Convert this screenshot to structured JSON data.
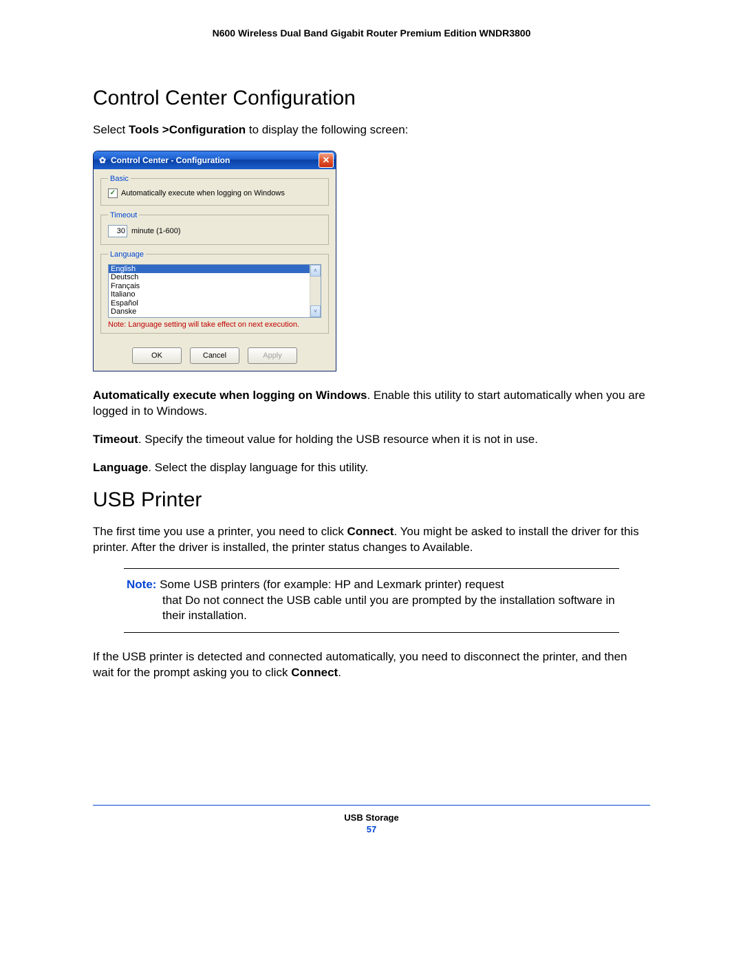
{
  "header": {
    "title": "N600 Wireless Dual Band Gigabit Router Premium Edition WNDR3800"
  },
  "section1": {
    "heading": "Control Center Configuration",
    "intro_prefix": "Select ",
    "intro_bold": "Tools >Configuration",
    "intro_suffix": " to display the following screen:"
  },
  "dialog": {
    "title": "Control Center - Configuration",
    "close_glyph": "✕",
    "gear_glyph": "✿",
    "check_glyph": "✓",
    "basic": {
      "legend": "Basic",
      "checkbox_label": "Automatically execute when logging on Windows",
      "checked": true
    },
    "timeout": {
      "legend": "Timeout",
      "value": "30",
      "unit": "minute (1-600)"
    },
    "language": {
      "legend": "Language",
      "items": [
        "English",
        "Deutsch",
        "Français",
        "Italiano",
        "Español",
        "Danske"
      ],
      "selected_index": 0,
      "note": "Note: Language setting will take effect on next execution.",
      "scroll_up": "˄",
      "scroll_down": "˅"
    },
    "buttons": {
      "ok": "OK",
      "cancel": "Cancel",
      "apply": "Apply"
    }
  },
  "descriptions": {
    "auto_bold": "Automatically execute when logging on Windows",
    "auto_text": ". Enable this utility to start automatically when you are logged in to Windows.",
    "timeout_bold": "Timeout",
    "timeout_text": ". Specify the timeout value for holding the USB resource when it is not in use.",
    "language_bold": "Language",
    "language_text": ". Select the display language for this utility."
  },
  "section2": {
    "heading": "USB Printer",
    "p1_a": "The first time you use a printer, you need to click ",
    "p1_bold": "Connect",
    "p1_b": ". You might be asked to install the driver for this printer. After the driver is installed, the printer status changes to Available.",
    "note_label": "Note:",
    "note_first": " Some USB printers (for example: HP and Lexmark printer) request",
    "note_rest": "that Do not connect the USB cable until you are prompted by the installation software in their installation.",
    "p2_a": "If the USB printer is detected and connected automatically, you need to disconnect the printer, and then wait for the prompt asking you to click ",
    "p2_bold": "Connect",
    "p2_b": "."
  },
  "footer": {
    "section": "USB Storage",
    "page": "57"
  }
}
